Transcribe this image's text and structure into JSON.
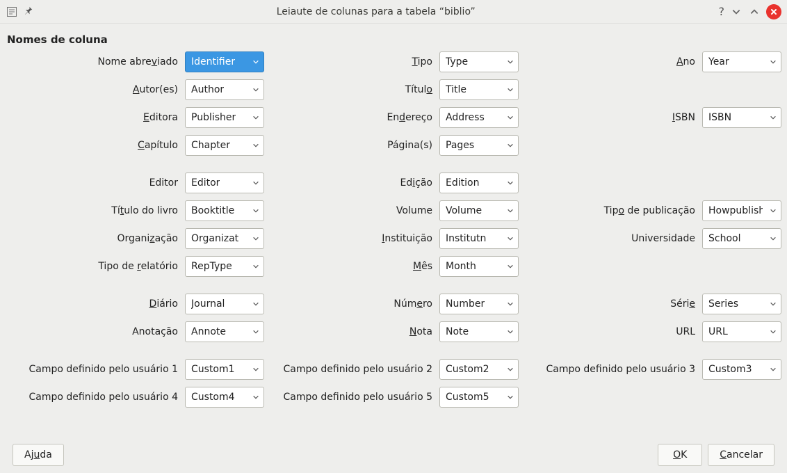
{
  "window": {
    "title": "Leiaute de colunas para a tabela “biblio”"
  },
  "section_title": "Nomes de coluna",
  "fields": {
    "short_name": {
      "label_before": "Nome abre",
      "underline": "v",
      "label_after": "iado",
      "value": "Identifier",
      "selected": true
    },
    "type": {
      "underline": "T",
      "label_after": "ipo",
      "value": "Type"
    },
    "year": {
      "underline": "A",
      "label_after": "no",
      "value": "Year"
    },
    "authors": {
      "underline": "A",
      "label_after": "utor(es)",
      "value": "Author"
    },
    "title": {
      "label_before": "Títul",
      "underline": "o",
      "value": "Title"
    },
    "publisher": {
      "underline": "E",
      "label_after": "ditora",
      "value": "Publisher"
    },
    "address": {
      "label_before": "En",
      "underline": "d",
      "label_after": "ereço",
      "value": "Address"
    },
    "isbn": {
      "underline": "I",
      "label_after": "SBN",
      "value": "ISBN"
    },
    "chapter": {
      "underline": "C",
      "label_after": "apítulo",
      "value": "Chapter"
    },
    "pages": {
      "label_before": "Página(s)",
      "value": "Pages"
    },
    "editor": {
      "label_before": "Editor",
      "value": "Editor"
    },
    "edition": {
      "label_before": "Ed",
      "underline": "i",
      "label_after": "ção",
      "value": "Edition"
    },
    "booktitle": {
      "label_before": "Tí",
      "underline": "t",
      "label_after": "ulo do livro",
      "value": "Booktitle"
    },
    "volume": {
      "label_before": "Volume",
      "value": "Volume"
    },
    "howpublished": {
      "label_before": "Tip",
      "underline": "o",
      "label_after": " de publicação",
      "value": "Howpublish"
    },
    "organization": {
      "label_before": "Organi",
      "underline": "z",
      "label_after": "ação",
      "value": "Organizat"
    },
    "institution": {
      "underline": "I",
      "label_after": "nstituição",
      "value": "Institutn"
    },
    "university": {
      "label_before": "Universidade",
      "value": "School"
    },
    "report_type": {
      "label_before": "Tipo de ",
      "underline": "r",
      "label_after": "elatório",
      "value": "RepType"
    },
    "month": {
      "underline": "M",
      "label_after": "ês",
      "value": "Month"
    },
    "journal": {
      "underline": "D",
      "label_after": "iário",
      "value": "Journal"
    },
    "number": {
      "label_before": "Núm",
      "underline": "e",
      "label_after": "ro",
      "value": "Number"
    },
    "series": {
      "label_before": "Séri",
      "underline": "e",
      "value": "Series"
    },
    "annotation": {
      "label_before": "Anotação",
      "value": "Annote"
    },
    "note": {
      "underline": "N",
      "label_after": "ota",
      "value": "Note"
    },
    "url": {
      "label_before": "URL",
      "value": "URL"
    },
    "custom1": {
      "label_before": "Campo definido pelo usuário 1",
      "value": "Custom1"
    },
    "custom2": {
      "label_before": "Campo definido pelo usuário 2",
      "value": "Custom2"
    },
    "custom3": {
      "label_before": "Campo definido pelo usuário 3",
      "value": "Custom3"
    },
    "custom4": {
      "label_before": "Campo definido pelo usuário 4",
      "value": "Custom4"
    },
    "custom5": {
      "label_before": "Campo definido pelo usuário 5",
      "value": "Custom5"
    }
  },
  "buttons": {
    "help": {
      "before": "Aj",
      "u": "u",
      "after": "da"
    },
    "ok": {
      "before": "",
      "u": "O",
      "after": "K"
    },
    "cancel": {
      "before": "",
      "u": "C",
      "after": "ancelar"
    }
  }
}
